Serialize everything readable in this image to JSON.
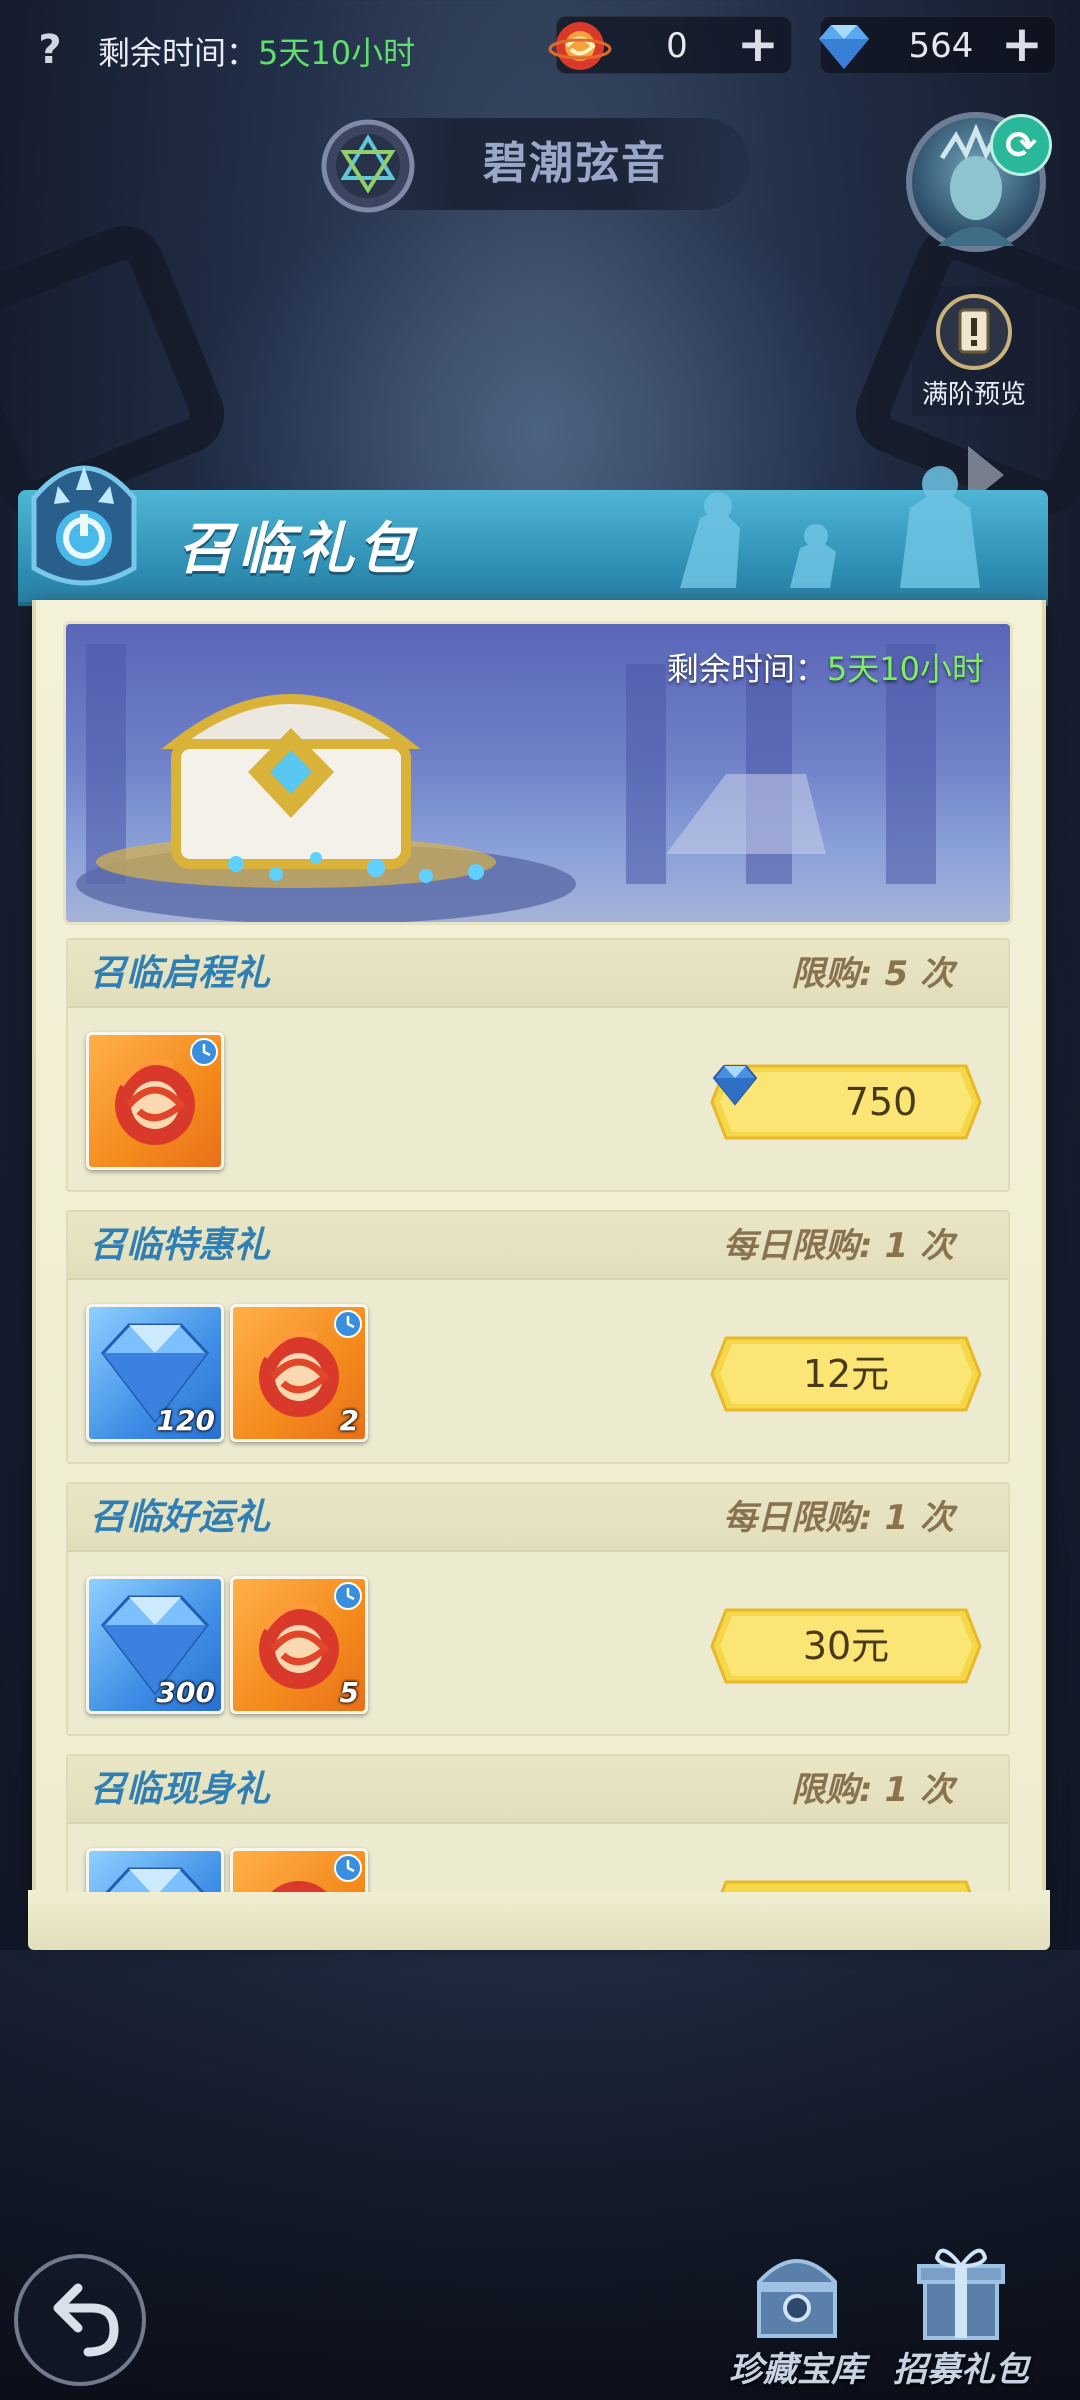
{
  "top_bar": {
    "help_glyph": "?",
    "timer_label": "剩余时间：",
    "timer_value": "5天10小时",
    "summon_currency": {
      "icon": "summon-orb-icon",
      "value": "0",
      "plus": "+"
    },
    "gem_currency": {
      "icon": "diamond-icon",
      "value": "564",
      "plus": "+"
    }
  },
  "event": {
    "title": "碧潮弦音"
  },
  "side": {
    "refresh_glyph": "⟳",
    "full_stage_label": "满阶预览"
  },
  "panel": {
    "title": "召临礼包",
    "banner_timer_label": "剩余时间：",
    "banner_timer_value": "5天10小时"
  },
  "packs": [
    {
      "name": "召临启程礼",
      "limit": "限购: 5 次",
      "items": [
        {
          "kind": "summon",
          "count": ""
        }
      ],
      "price": "750",
      "price_icon": "diamond-icon"
    },
    {
      "name": "召临特惠礼",
      "limit": "每日限购: 1 次",
      "items": [
        {
          "kind": "gem",
          "count": "120"
        },
        {
          "kind": "summon",
          "count": "2"
        }
      ],
      "price": "12元"
    },
    {
      "name": "召临好运礼",
      "limit": "每日限购: 1 次",
      "items": [
        {
          "kind": "gem",
          "count": "300"
        },
        {
          "kind": "summon",
          "count": "5"
        }
      ],
      "price": "30元"
    },
    {
      "name": "召临现身礼",
      "limit": "限购: 1 次",
      "items": [
        {
          "kind": "gem",
          "count": ""
        },
        {
          "kind": "summon",
          "count": ""
        }
      ],
      "price": ""
    }
  ],
  "bottom": {
    "treasure_label": "珍藏宝库",
    "recruit_label": "招募礼包"
  },
  "colors": {
    "accent_green": "#5ee06a",
    "header_blue": "#2e8eb3",
    "panel_cream": "#f3f1d8",
    "price_gold": "#f7d74a",
    "pack_name_blue": "#2f7fb4",
    "limit_brown": "#8a7250"
  }
}
